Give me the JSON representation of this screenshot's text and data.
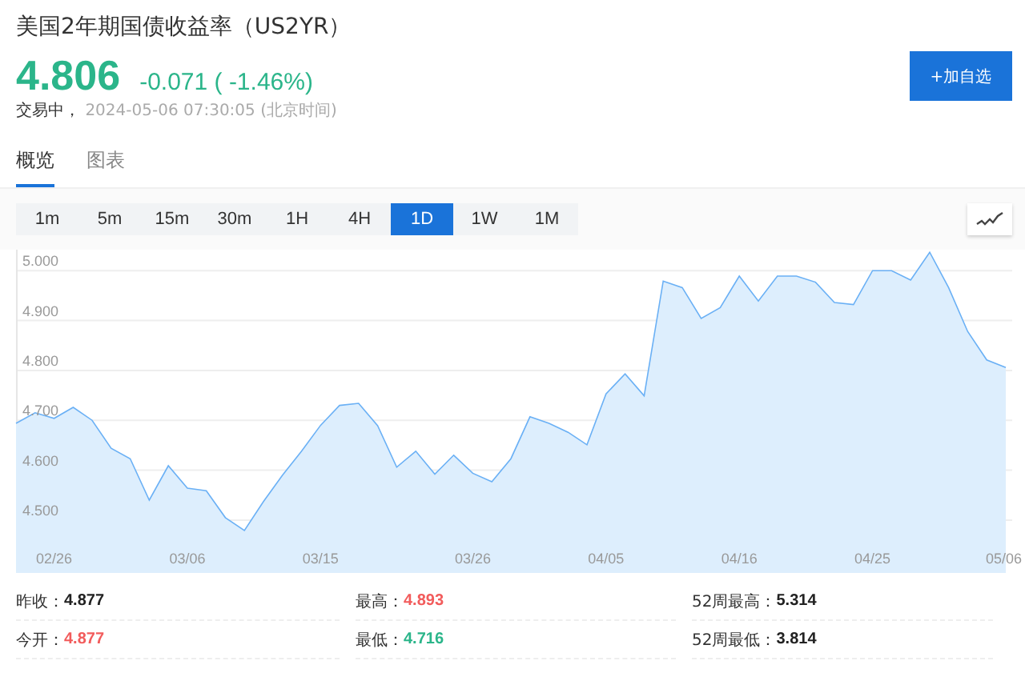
{
  "header": {
    "title": "美国2年期国债收益率（US2YR）",
    "price": "4.806",
    "change": "-0.071 ( -1.46%)",
    "status": "交易中，",
    "time": "2024-05-06 07:30:05 (北京时间)",
    "add_button": "+加自选"
  },
  "tabs": [
    {
      "label": "概览",
      "selected": true
    },
    {
      "label": "图表",
      "selected": false
    }
  ],
  "periods": [
    {
      "label": "1m",
      "selected": false
    },
    {
      "label": "5m",
      "selected": false
    },
    {
      "label": "15m",
      "selected": false
    },
    {
      "label": "30m",
      "selected": false
    },
    {
      "label": "1H",
      "selected": false
    },
    {
      "label": "4H",
      "selected": false
    },
    {
      "label": "1D",
      "selected": true
    },
    {
      "label": "1W",
      "selected": false
    },
    {
      "label": "1M",
      "selected": false
    }
  ],
  "chart": {
    "chart_data": {
      "type": "area",
      "categories": [
        null,
        null,
        "02/26",
        null,
        null,
        null,
        null,
        null,
        null,
        "03/06",
        null,
        null,
        null,
        null,
        null,
        null,
        "03/15",
        null,
        null,
        null,
        null,
        null,
        null,
        null,
        "03/26",
        null,
        null,
        null,
        null,
        null,
        null,
        "04/05",
        null,
        null,
        null,
        null,
        null,
        null,
        "04/16",
        null,
        null,
        null,
        null,
        null,
        null,
        "04/25",
        null,
        null,
        null,
        null,
        null,
        null,
        "05/06"
      ],
      "series": [
        {
          "color": "#6ab0f5",
          "values": [
            4.694,
            4.715,
            4.704,
            4.726,
            4.7,
            4.644,
            4.623,
            4.54,
            4.609,
            4.564,
            4.559,
            4.505,
            4.479,
            4.537,
            4.59,
            4.638,
            4.69,
            4.73,
            4.734,
            4.689,
            4.606,
            4.638,
            4.592,
            4.63,
            4.594,
            4.577,
            4.623,
            4.707,
            4.694,
            4.676,
            4.651,
            4.753,
            4.793,
            4.749,
            4.979,
            4.966,
            4.904,
            4.926,
            4.989,
            4.939,
            4.989,
            4.989,
            4.977,
            4.936,
            4.932,
            5.0,
            5.0,
            4.981,
            5.037,
            4.966,
            4.878,
            4.821,
            4.806
          ]
        }
      ],
      "grid": true,
      "ylim": [
        4.394,
        5.042
      ],
      "yticks": [
        {
          "value": 5.0,
          "label": "5.000"
        },
        {
          "value": 4.9,
          "label": "4.900"
        },
        {
          "value": 4.8,
          "label": "4.800"
        },
        {
          "value": 4.7,
          "label": "4.700"
        },
        {
          "value": 4.6,
          "label": "4.600"
        },
        {
          "value": 4.5,
          "label": "4.500"
        }
      ]
    }
  },
  "stats": [
    {
      "label": "昨收：",
      "value": "4.877",
      "color": "#222222"
    },
    {
      "label": "最高：",
      "value": "4.893",
      "color": "#f25c5c"
    },
    {
      "label": "52周最高：",
      "value": "5.314",
      "color": "#222222"
    },
    {
      "label": "今开：",
      "value": "4.877",
      "color": "#f25c5c"
    },
    {
      "label": "最低：",
      "value": "4.716",
      "color": "#2bb58a"
    },
    {
      "label": "52周最低：",
      "value": "3.814",
      "color": "#222222"
    }
  ]
}
